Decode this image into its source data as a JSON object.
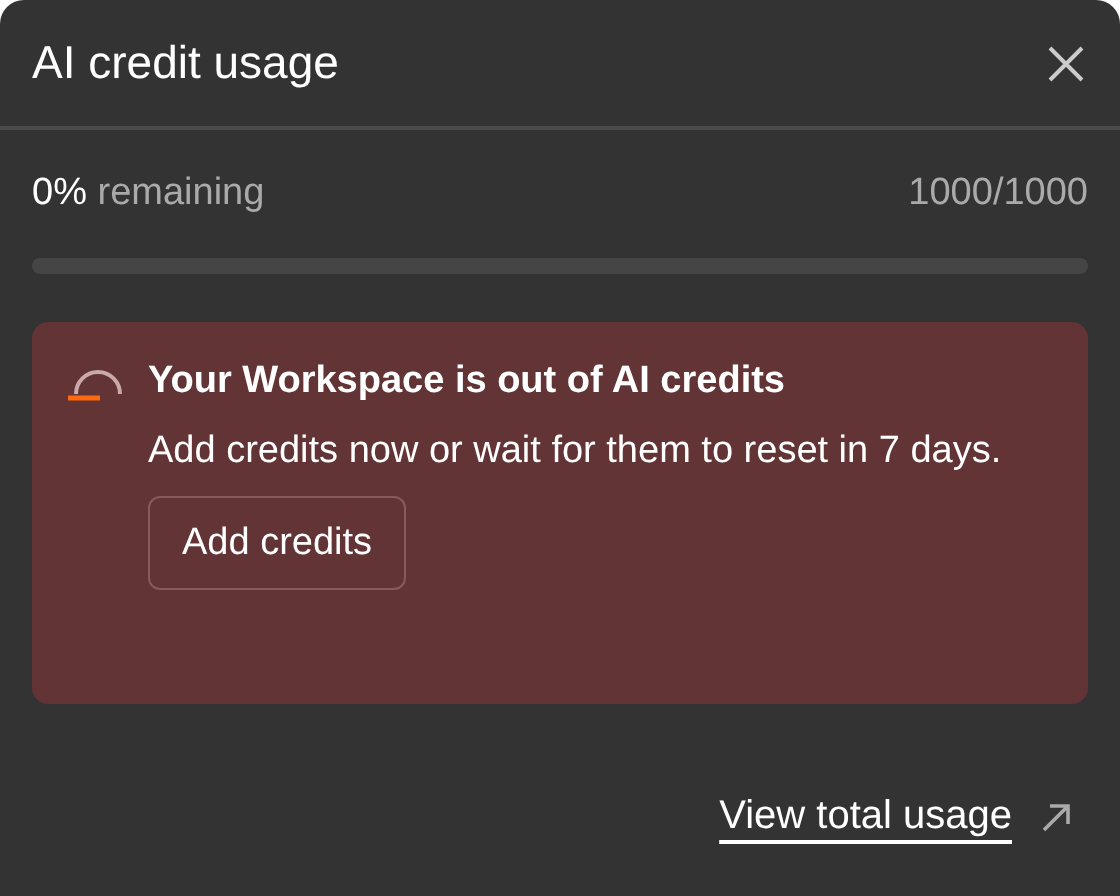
{
  "dialog": {
    "title": "AI credit usage"
  },
  "usage": {
    "percent": "0%",
    "label": "remaining",
    "count": "1000/1000",
    "level": 0
  },
  "alert": {
    "title": "Your Workspace is out of AI credits",
    "message": "Add credits now or wait for them to reset in 7 days.",
    "button": "Add credits"
  },
  "footer": {
    "link": "View total usage"
  }
}
